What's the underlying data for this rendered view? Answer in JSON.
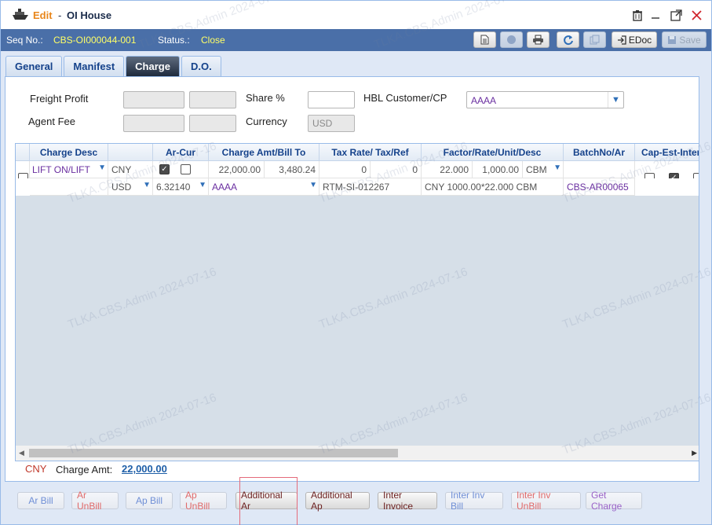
{
  "title": {
    "mode": "Edit",
    "separator": "-",
    "name": "OI House"
  },
  "seqbar": {
    "seq_label": "Seq No.:",
    "seq_value": "CBS-OI000044-001",
    "status_label": "Status.:",
    "status_value": "Close",
    "edoc_label": "EDoc",
    "save_label": "Save"
  },
  "tabs": [
    "General",
    "Manifest",
    "Charge",
    "D.O."
  ],
  "form": {
    "freight_profit_label": "Freight Profit",
    "agent_fee_label": "Agent Fee",
    "share_label": "Share %",
    "currency_label": "Currency",
    "currency_value": "USD",
    "hbl_label": "HBL Customer/CP",
    "hbl_value": "AAAA"
  },
  "grid": {
    "columns": [
      "Charge Desc",
      "Ar-Cur",
      "Charge Amt/Bill To",
      "Tax Rate/ Tax/Ref",
      "Factor/Rate/Unit/Desc",
      "BatchNo/Ar",
      "Cap-Est-Inter"
    ],
    "row": {
      "charge_desc": "LIFT ON/LIFT",
      "cur1": "CNY",
      "cur2": "USD",
      "ex_rate": "6.32140",
      "amt1": "22,000.00",
      "amt2": "3,480.24",
      "bill_to": "AAAA",
      "tax_rate": "0",
      "tax": "0",
      "tax_ref": "RTM-SI-012267",
      "factor": "22.000",
      "rate": "1,000.00",
      "unit": "CBM",
      "desc": "CNY 1000.00*22.000 CBM",
      "batch": "CBS-AR00065"
    }
  },
  "summary": {
    "currency": "CNY",
    "label": "Charge Amt:",
    "value": "22,000.00"
  },
  "buttons": [
    "Ar Bill",
    "Ar UnBill",
    "Ap Bill",
    "Ap UnBill",
    "Additional Ar",
    "Additional Ap",
    "Inter Invoice",
    "Inter Inv Bill",
    "Inter Inv UnBill",
    "Get Charge"
  ],
  "watermark": "TLKA.CBS.Admin 2024-07-16",
  "colors": {
    "header": "#4a6fa8",
    "accent": "#e8861b",
    "status": "#ffff66"
  }
}
